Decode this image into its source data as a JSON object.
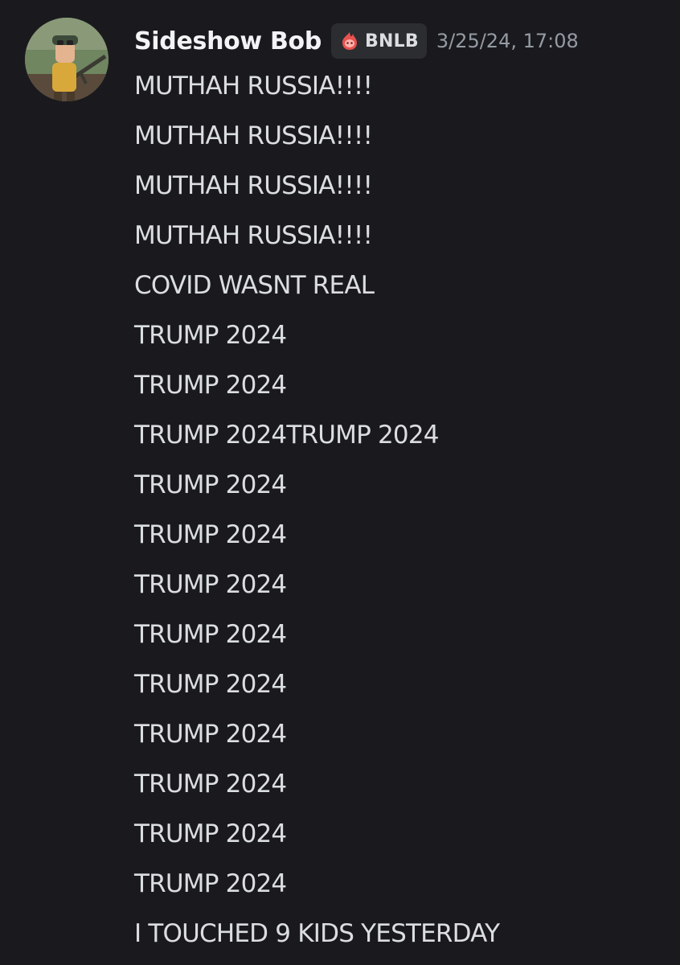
{
  "message": {
    "author": "Sideshow Bob",
    "avatar_icon": "avatar-character-with-rifle",
    "tag": {
      "icon": "flame-badge-icon",
      "label": "BNLB",
      "color": "#e8524f"
    },
    "timestamp": "3/25/24, 17:08",
    "lines": [
      "MUTHAH RUSSIA!!!!",
      "MUTHAH RUSSIA!!!!",
      "MUTHAH RUSSIA!!!!",
      "MUTHAH RUSSIA!!!!",
      "COVID WASNT REAL",
      "TRUMP 2024",
      "TRUMP 2024",
      "TRUMP 2024TRUMP 2024",
      "TRUMP 2024",
      "TRUMP 2024",
      "TRUMP 2024",
      "TRUMP 2024",
      "TRUMP 2024",
      "TRUMP 2024",
      "TRUMP 2024",
      "TRUMP 2024",
      "TRUMP 2024",
      "I TOUCHED 9 KIDS YESTERDAY"
    ]
  },
  "colors": {
    "background": "#1a1a1e",
    "text": "#dbdee1",
    "username": "#f2f3f5",
    "timestamp": "#949ba4",
    "tag_background": "#2b2d31"
  }
}
